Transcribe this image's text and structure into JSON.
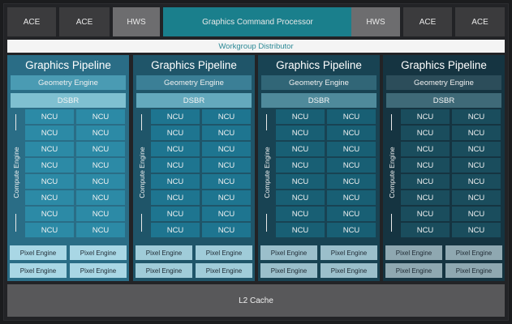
{
  "top_bar": {
    "blocks": [
      "ACE",
      "ACE",
      "HWS",
      "Graphics Command Processor",
      "HWS",
      "ACE",
      "ACE"
    ]
  },
  "workgroup_distributor": "Workgroup Distributor",
  "pipelines": [
    {
      "title": "Graphics Pipeline",
      "geometry_engine": "Geometry Engine",
      "dsbr": "DSBR",
      "compute_engine": "Compute Engine",
      "ncu_label": "NCU",
      "pixel_engine": "Pixel Engine",
      "colors": {
        "outer": "#2a6d86",
        "geo": "#4a9bb3",
        "dsbr": "#7fc0d1",
        "ncu": "#2c8aa6",
        "pixel": "#a9d7e5"
      }
    },
    {
      "title": "Graphics Pipeline",
      "geometry_engine": "Geometry Engine",
      "dsbr": "DSBR",
      "compute_engine": "Compute Engine",
      "ncu_label": "NCU",
      "pixel_engine": "Pixel Engine",
      "colors": {
        "outer": "#1f5569",
        "geo": "#3b7f96",
        "dsbr": "#64a9bd",
        "ncu": "#1e7590",
        "pixel": "#a0ccd9"
      }
    },
    {
      "title": "Graphics Pipeline",
      "geometry_engine": "Geometry Engine",
      "dsbr": "DSBR",
      "compute_engine": "Compute Engine",
      "ncu_label": "NCU",
      "pixel_engine": "Pixel Engine",
      "colors": {
        "outer": "#184353",
        "geo": "#316677",
        "dsbr": "#4f8a9b",
        "ncu": "#185f74",
        "pixel": "#9bbfcb"
      }
    },
    {
      "title": "Graphics Pipeline",
      "geometry_engine": "Geometry Engine",
      "dsbr": "DSBR",
      "compute_engine": "Compute Engine",
      "ncu_label": "NCU",
      "pixel_engine": "Pixel Engine",
      "colors": {
        "outer": "#153441",
        "geo": "#2c4d5a",
        "dsbr": "#3f6a78",
        "ncu": "#1a4d5d",
        "pixel": "#8fa8b1"
      }
    }
  ],
  "l2_cache": "L2 Cache"
}
